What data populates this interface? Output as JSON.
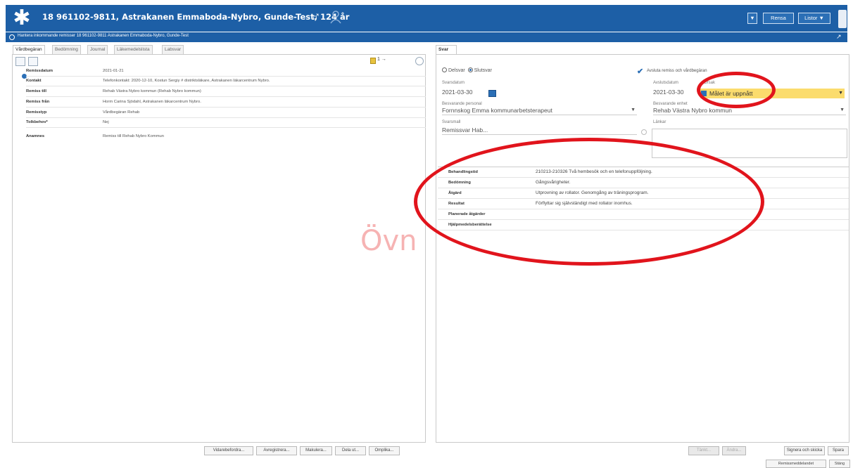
{
  "window": {
    "patient_title": "18 961102-9811, Astrakanen Emmaboda-Nybro, Gunde-Test, 124 år",
    "buttons": [
      "▼",
      "Rensa",
      "Listor ▼"
    ],
    "icons": [
      "app-logo-icon",
      "male-icon",
      "person-icon",
      "phone-icon"
    ]
  },
  "subbar": {
    "text": "Hantera inkommande remisser 18 961102-9811 Astrakanen Emmaboda-Nybro, Gunde-Test",
    "resize": "↗"
  },
  "left": {
    "tabs": [
      "Vårdbegäran",
      "Bedömning",
      "Journal",
      "Läkemedelslista",
      "Labsvar"
    ],
    "counter": "1 →",
    "fields": [
      {
        "label": "Remissdatum",
        "value": "2021-01-21"
      },
      {
        "label": "Kontakt",
        "value": "Telefonkontakt: 2020-12-10, Kostun Sergiy # distriktsläkare, Astrakanen läkarcentrum Nybro."
      },
      {
        "label": "Remiss till",
        "value": "Rehab Västra Nybro kommun (Rehab Nybro kommun)"
      },
      {
        "label": "Remiss från",
        "value": "Horm Carina Sjödahl, Astrakanen läkarcentrum Nybro."
      },
      {
        "label": "Remisstyp",
        "value": "Vårdbegäran Rehab"
      },
      {
        "label": "Tolkbehov*",
        "value": "Nej"
      },
      {
        "label": "Anamnes",
        "value": "Remiss till Rehab Nybro Kommun"
      }
    ],
    "buttons": [
      "Vidarebefordra...",
      "Avregistrera...",
      "Makulera...",
      "Dela ut...",
      "Omplika..."
    ]
  },
  "watermark": "Övn",
  "right": {
    "tab": "Svar",
    "radios": [
      {
        "label": "Delsvar",
        "selected": false
      },
      {
        "label": "Slutsvar",
        "selected": true
      }
    ],
    "checkbox_label": "Avsluta remiss och vårdbegäran",
    "svarsdatum_label": "Svarsdatum",
    "svarsdatum_value": "2021-03-30",
    "avslutsdatum_label": "Avslutsdatum",
    "avslutsdatum_value": "2021-03-30",
    "orsak_label": "Orsak",
    "orsak_value": "Målet är uppnått",
    "personal_label": "Besvarande personal",
    "personal_value": "Fornnskog Emma kommunarbetsterapeut",
    "enhet_label": "Besvarande enhet",
    "enhet_value": "Rehab Västra Nybro kommun",
    "svarsmall_label": "Svarsmall",
    "svarsmall_value": "Remissvar Hab...",
    "lankar_label": "Länkar",
    "results": [
      {
        "label": "Behandlingstid",
        "value": "210213-210326 Två hembesök och en telefonuppföljning."
      },
      {
        "label": "Bedömning",
        "value": "Gångsvårigheter."
      },
      {
        "label": "Åtgärd",
        "value": "Utprovning av rollator. Genomgång av träningsprogram."
      },
      {
        "label": "Resultat",
        "value": "Förflyttar sig självständigt med rollator inomhus."
      },
      {
        "label": "Planerade åtgärder",
        "value": ""
      },
      {
        "label": "Hjälpmedelsberättelse",
        "value": ""
      }
    ],
    "buttons": [
      {
        "label": "Tänkt...",
        "disabled": true
      },
      {
        "label": "Ändra...",
        "disabled": true
      },
      {
        "label": "Signera och skicka",
        "disabled": false
      },
      {
        "label": "Spara",
        "disabled": false
      }
    ]
  },
  "footer": {
    "buttons": [
      "Remissmeddelandet",
      "Stäng"
    ]
  },
  "colors": {
    "titlebar": "#1d5fa6",
    "highlight": "#fbdc6d",
    "annotation": "#e1141c",
    "watermark": "#f6b3b3"
  }
}
